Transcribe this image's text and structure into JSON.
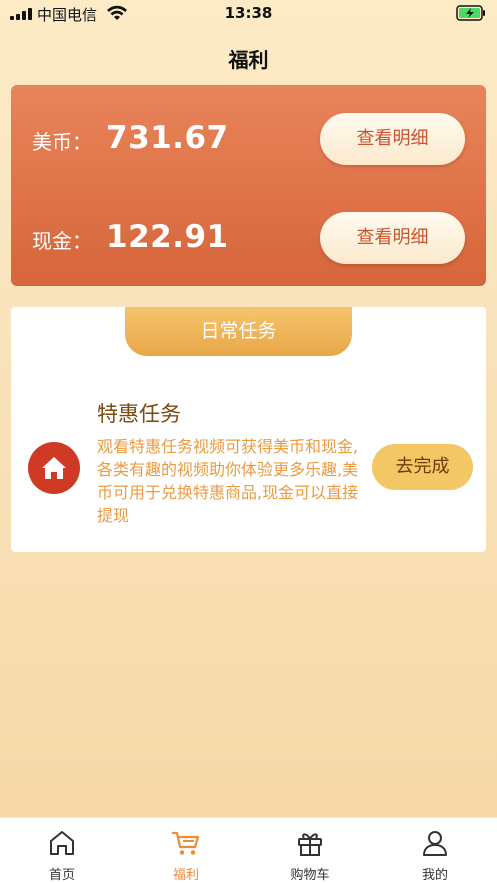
{
  "status_bar": {
    "carrier": "中国电信",
    "time": "13:38"
  },
  "header": {
    "title": "福利"
  },
  "balances": [
    {
      "label": "美币：",
      "value": "731.67",
      "button_label": "查看明细"
    },
    {
      "label": "现金：",
      "value": "122.91",
      "button_label": "查看明细"
    }
  ],
  "daily_tasks": {
    "tab_label": "日常任务",
    "task": {
      "title": "特惠任务",
      "description": "观看特惠任务视频可获得美币和现金,各类有趣的视频助你体验更多乐趣,美币可用于兑换特惠商品,现金可以直接提现",
      "button_label": "去完成",
      "icon": "home-icon"
    }
  },
  "tab_bar": {
    "items": [
      {
        "label": "首页",
        "icon": "home-outline-icon",
        "active": false
      },
      {
        "label": "福利",
        "icon": "cart-icon",
        "active": true
      },
      {
        "label": "购物车",
        "icon": "gift-icon",
        "active": false
      },
      {
        "label": "我的",
        "icon": "user-icon",
        "active": false
      }
    ]
  },
  "colors": {
    "accent": "#ef8a37",
    "card_top": "#e9845a",
    "card_bottom": "#d6653b",
    "task_icon_bg": "#cf3a24",
    "complete_button": "#f4c765"
  }
}
